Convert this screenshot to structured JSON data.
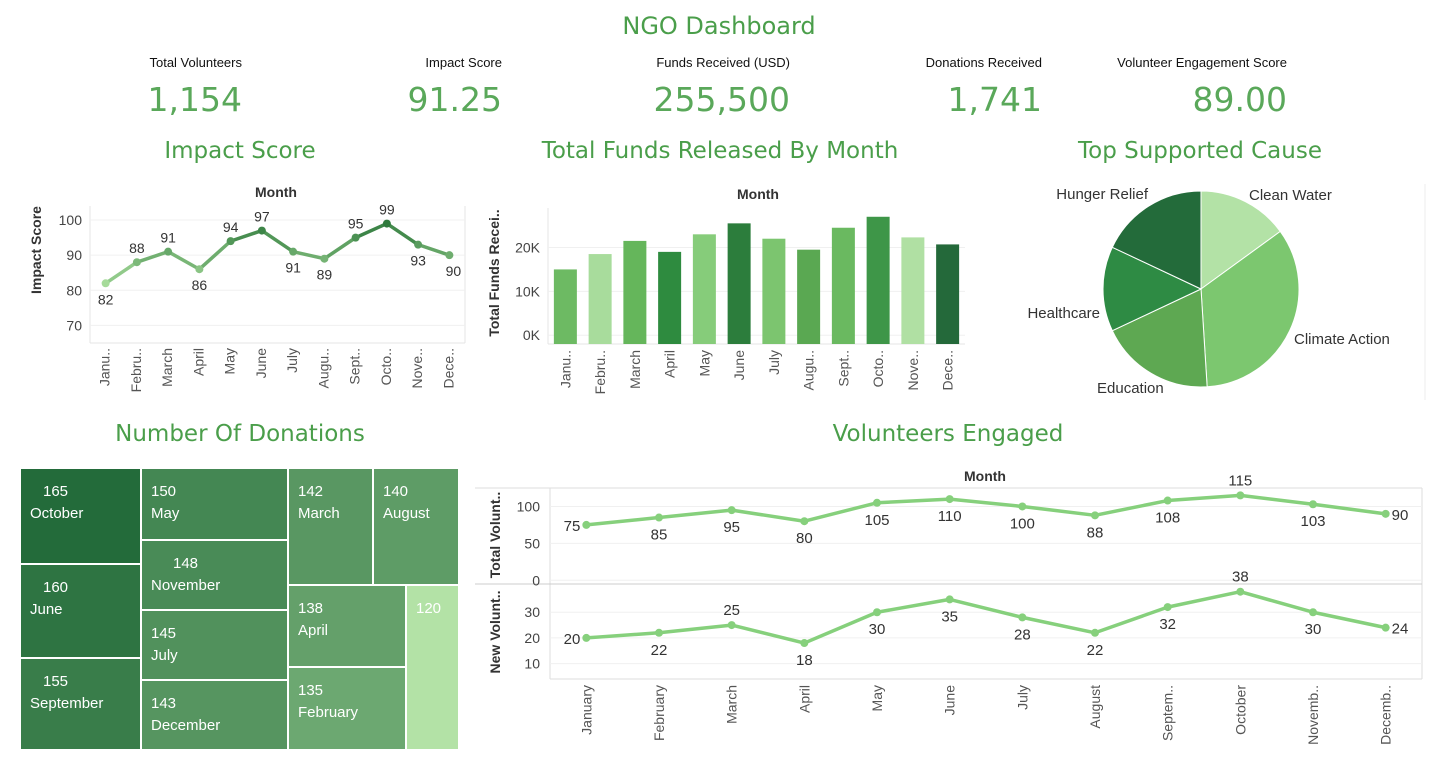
{
  "dashboard": {
    "title": "NGO Dashboard"
  },
  "kpis": [
    {
      "label": "Total Volunteers",
      "value": "1,154"
    },
    {
      "label": "Impact Score",
      "value": "91.25"
    },
    {
      "label": "Funds Received (USD)",
      "value": "255,500"
    },
    {
      "label": "Donations Received",
      "value": "1,741"
    },
    {
      "label": "Volunteer Engagement Score",
      "value": "89.00"
    }
  ],
  "colors": {
    "title_green": "#4a9e4a",
    "kpi_green": "#5aa85a",
    "line_green": "#86d07c"
  },
  "chart_data": [
    {
      "id": "impact",
      "section_title": "Impact Score",
      "type": "line",
      "title": "Month",
      "ylabel": "Impact Score",
      "ylim": [
        65,
        104
      ],
      "yticks": [
        70,
        80,
        90,
        100
      ],
      "categories": [
        "Janu..",
        "Febru..",
        "March",
        "April",
        "May",
        "June",
        "July",
        "Augu..",
        "Sept..",
        "Octo..",
        "Nove..",
        "Dece.."
      ],
      "values": [
        82,
        88,
        91,
        86,
        94,
        97,
        91,
        89,
        95,
        99,
        93,
        90
      ],
      "grid": true
    },
    {
      "id": "funds",
      "section_title": "Total Funds Released By Month",
      "type": "bar",
      "title": "Month",
      "ylabel": "Total Funds Recei..",
      "ylim": [
        -2000,
        29000
      ],
      "yticks": [
        0,
        10000,
        20000
      ],
      "ytick_labels": [
        "0K",
        "10K",
        "20K"
      ],
      "categories": [
        "Janu..",
        "Febru..",
        "March",
        "April",
        "May",
        "June",
        "July",
        "Augu..",
        "Sept..",
        "Octo..",
        "Nove..",
        "Dece.."
      ],
      "values": [
        15000,
        18500,
        21500,
        19000,
        23000,
        25500,
        22000,
        19500,
        24500,
        27000,
        22300,
        20700
      ],
      "colors": [
        "#6dba63",
        "#a8dc9c",
        "#65b65b",
        "#2e8b3f",
        "#86cc7a",
        "#2c7d3c",
        "#7cc56f",
        "#5aa852",
        "#6ab960",
        "#3e9648",
        "#b0e0a3",
        "#24693a"
      ],
      "grid": true
    },
    {
      "id": "cause",
      "section_title": "Top Supported Cause",
      "type": "pie",
      "labels": [
        "Clean Water",
        "Climate Action",
        "Education",
        "Healthcare",
        "Hunger Relief"
      ],
      "values": [
        15,
        34,
        19,
        14,
        18
      ],
      "colors": [
        "#b3e2a6",
        "#7cc76f",
        "#5ea852",
        "#2e8b44",
        "#236b3a"
      ]
    },
    {
      "id": "donations",
      "section_title": "Number Of Donations",
      "type": "treemap",
      "items": [
        {
          "label": "October",
          "value": 165
        },
        {
          "label": "June",
          "value": 160
        },
        {
          "label": "September",
          "value": 155
        },
        {
          "label": "May",
          "value": 150
        },
        {
          "label": "November",
          "value": 148
        },
        {
          "label": "July",
          "value": 145
        },
        {
          "label": "December",
          "value": 143
        },
        {
          "label": "March",
          "value": 142
        },
        {
          "label": "August",
          "value": 140
        },
        {
          "label": "April",
          "value": 138
        },
        {
          "label": "February",
          "value": 135
        },
        {
          "label": "",
          "value": 120
        }
      ]
    },
    {
      "id": "volunteers",
      "section_title": "Volunteers Engaged",
      "type": "line",
      "title": "Month",
      "categories": [
        "January",
        "February",
        "March",
        "April",
        "May",
        "June",
        "July",
        "August",
        "Septem..",
        "October",
        "Novemb..",
        "Decemb.."
      ],
      "series": [
        {
          "name": "Total Volunt..",
          "values": [
            75,
            85,
            95,
            80,
            105,
            110,
            100,
            88,
            108,
            115,
            103,
            90
          ],
          "ylim": [
            -5,
            125
          ],
          "yticks": [
            0,
            50,
            100
          ]
        },
        {
          "name": "New Volunt..",
          "values": [
            20,
            22,
            25,
            18,
            30,
            35,
            28,
            22,
            32,
            38,
            30,
            24
          ],
          "ylim": [
            4,
            41
          ],
          "yticks": [
            10,
            20,
            30
          ]
        }
      ],
      "grid": true
    }
  ]
}
